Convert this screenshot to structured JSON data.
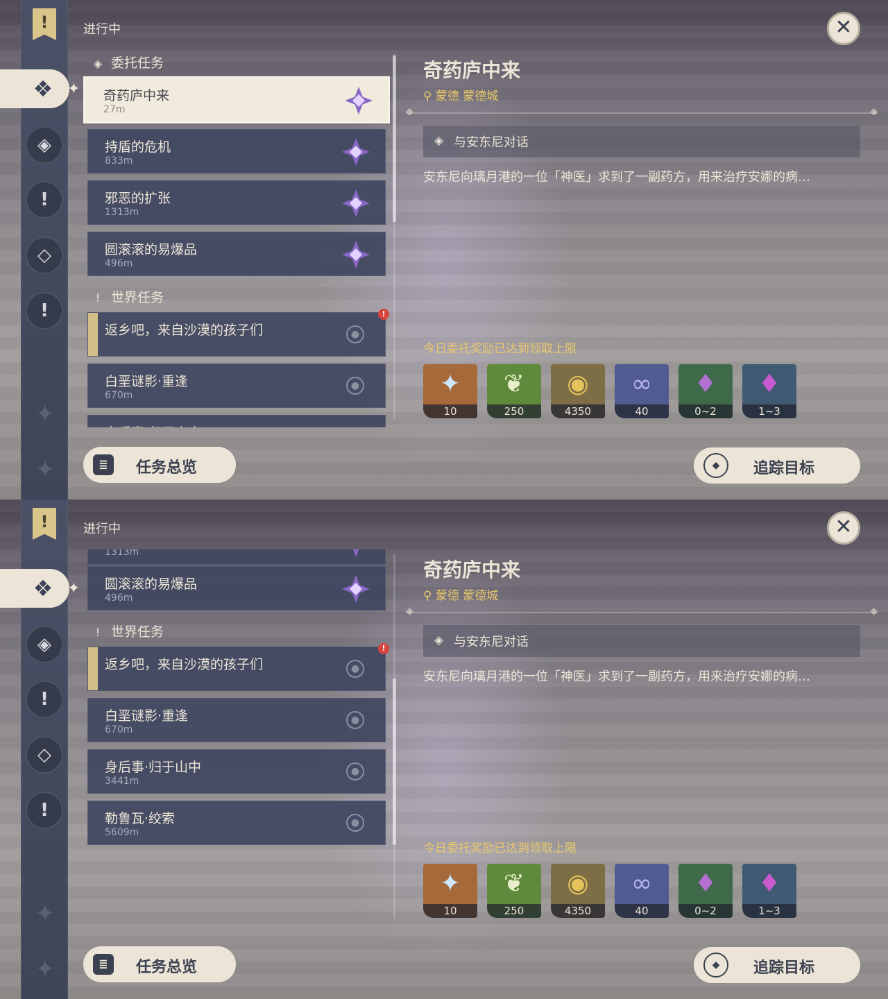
{
  "header": {
    "in_progress": "进行中"
  },
  "sidebar": {
    "banner_icon": "quest-banner-icon",
    "active_icon": "commission-icon",
    "items": [
      "archon-quest-icon",
      "world-quest-icon",
      "story-quest-icon",
      "event-quest-icon"
    ]
  },
  "sections": {
    "commission": "委托任务",
    "world": "世界任务"
  },
  "quests": [
    {
      "name": "奇药庐中来",
      "distance": "27m"
    },
    {
      "name": "持盾的危机",
      "distance": "833m"
    },
    {
      "name": "邪恶的扩张",
      "distance": "1313m"
    },
    {
      "name": "圆滚滚的易爆品",
      "distance": "496m"
    },
    {
      "name": "返乡吧，来自沙漠的孩子们",
      "distance": ""
    },
    {
      "name": "白垩谜影·重逢",
      "distance": "670m"
    },
    {
      "name": "身后事·归于山中",
      "distance": "3441m"
    },
    {
      "name": "勒鲁瓦·绞索",
      "distance": "5609m"
    }
  ],
  "detail": {
    "title": "奇药庐中来",
    "location": "蒙德 蒙德城",
    "step": "与安东尼对话",
    "description": "安东尼向璃月港的一位「神医」求到了一副药方，用来治疗安娜的病…",
    "reward_note": "今日委托奖励已达到领取上限",
    "rewards": [
      {
        "icon": "primogem-icon",
        "count": "10",
        "color": "#a5693a"
      },
      {
        "icon": "adventure-exp-icon",
        "count": "250",
        "color": "#5f8a3c"
      },
      {
        "icon": "mora-icon",
        "count": "4350",
        "color": "#7e6e46"
      },
      {
        "icon": "companionship-exp-icon",
        "count": "40",
        "color": "#4f5b91"
      },
      {
        "icon": "crystal-icon",
        "count": "0~2",
        "color": "#3f6a4a"
      },
      {
        "icon": "crystal-cluster-icon",
        "count": "1~3",
        "color": "#3f5a72"
      }
    ]
  },
  "buttons": {
    "overview": "任务总览",
    "track": "追踪目标"
  },
  "colors": {
    "cream": "#ece5d7",
    "gold": "#e8c86b",
    "slate": "#3f475f",
    "purple": "#8a68c6"
  }
}
